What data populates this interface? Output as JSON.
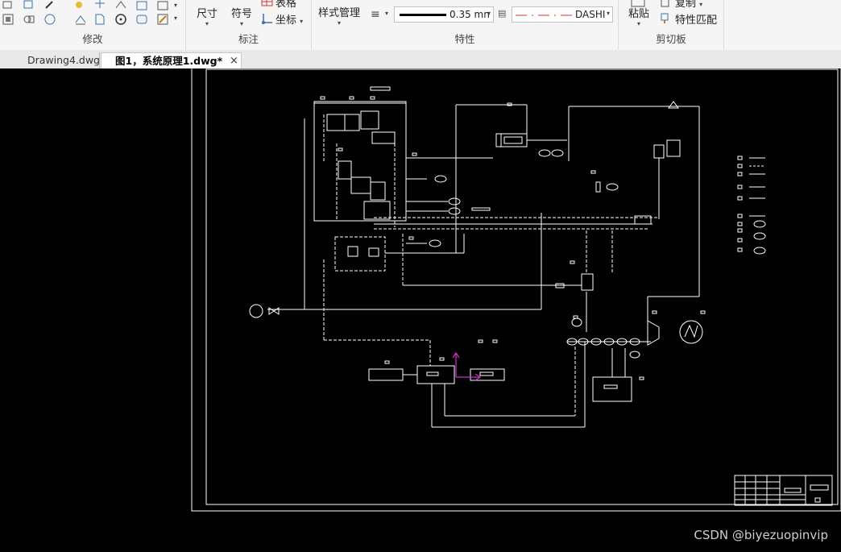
{
  "ribbon": {
    "groups": {
      "modify": {
        "label": "修改"
      },
      "annotation": {
        "label": "标注",
        "dimension": "尺寸",
        "symbol": "符号",
        "table": "表格",
        "coordinate": "坐标"
      },
      "properties": {
        "label": "特性",
        "style_manager": "样式管理",
        "lineweight": "0.35 mn",
        "linetype": "DASHI"
      },
      "clipboard": {
        "label": "剪切板",
        "paste": "粘贴",
        "copy": "复制",
        "match_properties": "特性匹配"
      }
    }
  },
  "tabs": [
    {
      "label": "Drawing4.dwg"
    },
    {
      "label": "图1，系统原理1.dwg*"
    }
  ],
  "watermark": "CSDN @biyezuopinvip",
  "colors": {
    "canvas": "#000000",
    "lines": "#ffffff",
    "ucs": "#cc33cc",
    "linetype_red": "#d33333"
  }
}
